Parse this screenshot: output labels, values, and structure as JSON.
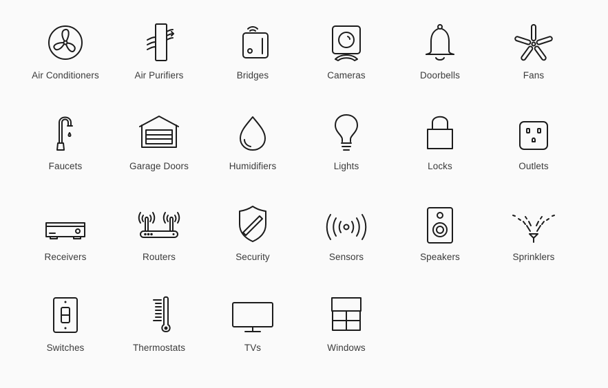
{
  "accessory_categories": [
    {
      "label": "Air Conditioners",
      "icon": "air-conditioner-icon"
    },
    {
      "label": "Air Purifiers",
      "icon": "air-purifier-icon"
    },
    {
      "label": "Bridges",
      "icon": "bridge-icon"
    },
    {
      "label": "Cameras",
      "icon": "camera-icon"
    },
    {
      "label": "Doorbells",
      "icon": "doorbell-icon"
    },
    {
      "label": "Fans",
      "icon": "fan-icon"
    },
    {
      "label": "Faucets",
      "icon": "faucet-icon"
    },
    {
      "label": "Garage Doors",
      "icon": "garage-door-icon"
    },
    {
      "label": "Humidifiers",
      "icon": "humidifier-icon"
    },
    {
      "label": "Lights",
      "icon": "light-bulb-icon"
    },
    {
      "label": "Locks",
      "icon": "lock-icon"
    },
    {
      "label": "Outlets",
      "icon": "outlet-icon"
    },
    {
      "label": "Receivers",
      "icon": "receiver-icon"
    },
    {
      "label": "Routers",
      "icon": "router-icon"
    },
    {
      "label": "Security",
      "icon": "security-shield-icon"
    },
    {
      "label": "Sensors",
      "icon": "sensor-icon"
    },
    {
      "label": "Speakers",
      "icon": "speaker-icon"
    },
    {
      "label": "Sprinklers",
      "icon": "sprinkler-icon"
    },
    {
      "label": "Switches",
      "icon": "switch-icon"
    },
    {
      "label": "Thermostats",
      "icon": "thermostat-icon"
    },
    {
      "label": "TVs",
      "icon": "tv-icon"
    },
    {
      "label": "Windows",
      "icon": "window-icon"
    }
  ]
}
